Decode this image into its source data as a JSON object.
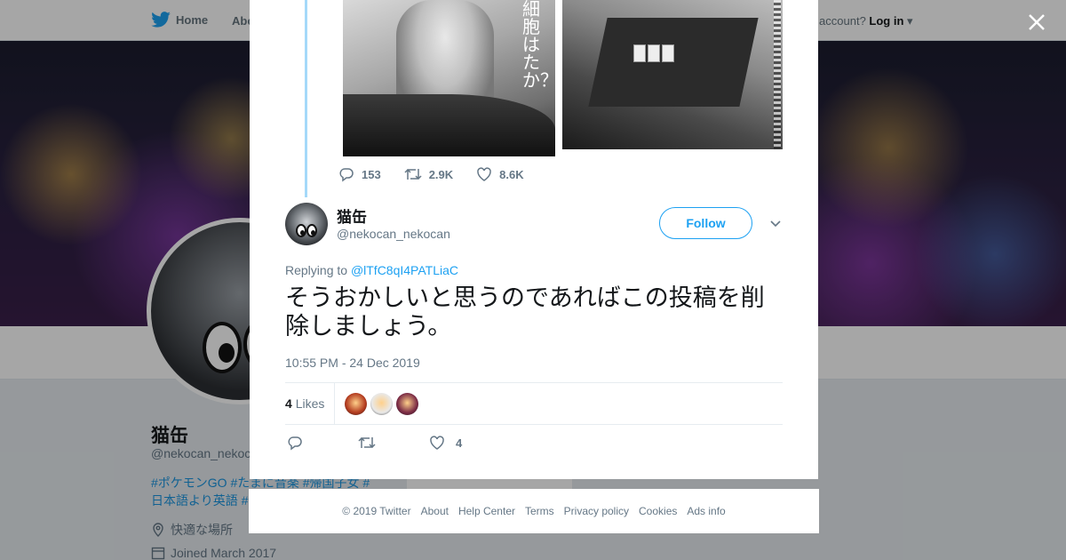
{
  "nav": {
    "home_label": "Home",
    "about_label": "About",
    "account_prompt": "Have an account?",
    "login_label": "Log in"
  },
  "profile": {
    "name": "猫缶",
    "handle": "@nekocan_nekocan",
    "bio": "#ポケモンGO #たまに音楽 #帰国子女 # 日本語より英語 #",
    "location": "快適な場所",
    "joined": "Joined March 2017"
  },
  "quoted_tweet": {
    "image_text": "細胞はたか？",
    "replies": "153",
    "retweets": "2.9K",
    "likes": "8.6K"
  },
  "tweet": {
    "author_name": "猫缶",
    "author_handle": "@nekocan_nekocan",
    "follow_label": "Follow",
    "replying_prefix": "Replying to ",
    "replying_to": "@lTfC8qI4PATLiaC",
    "text": "そうおかしいと思うのであればこの投稿を削除しましょう。",
    "timestamp": "10:55 PM - 24 Dec 2019",
    "likes_count": "4",
    "likes_label": "Likes",
    "action_like_count": "4"
  },
  "likers": [
    {
      "color": "#b23a1e"
    },
    {
      "color": "#e9e9e9"
    },
    {
      "color": "#7a2a44"
    }
  ],
  "footer": {
    "copyright": "© 2019 Twitter",
    "links": [
      "About",
      "Help Center",
      "Terms",
      "Privacy policy",
      "Cookies",
      "Ads info"
    ]
  },
  "colors": {
    "accent": "#1da1f2",
    "thread_line": "#a4d9f9",
    "muted": "#657786"
  }
}
